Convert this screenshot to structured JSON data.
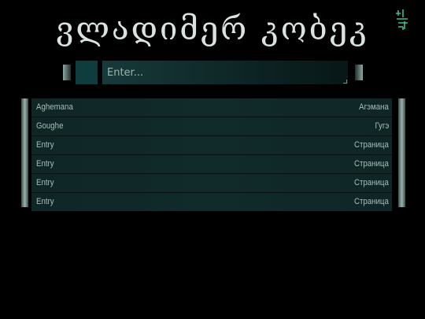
{
  "header": {
    "title": "ვლადიმერ კობეკ",
    "corner_icon": "language-glyph-icon"
  },
  "search": {
    "placeholder": "Enter..."
  },
  "list": {
    "rows": [
      {
        "left": "Aghemana",
        "right": "Агэмана"
      },
      {
        "left": "Goughe",
        "right": "Гугэ"
      },
      {
        "left": "Entry",
        "right": "Страница"
      },
      {
        "left": "Entry",
        "right": "Страница"
      },
      {
        "left": "Entry",
        "right": "Страница"
      },
      {
        "left": "Entry",
        "right": "Страница"
      }
    ]
  },
  "colors": {
    "background": "#000000",
    "accent": "#3fbf8f",
    "row": "#112b2a",
    "text": "#a9bdb8"
  }
}
